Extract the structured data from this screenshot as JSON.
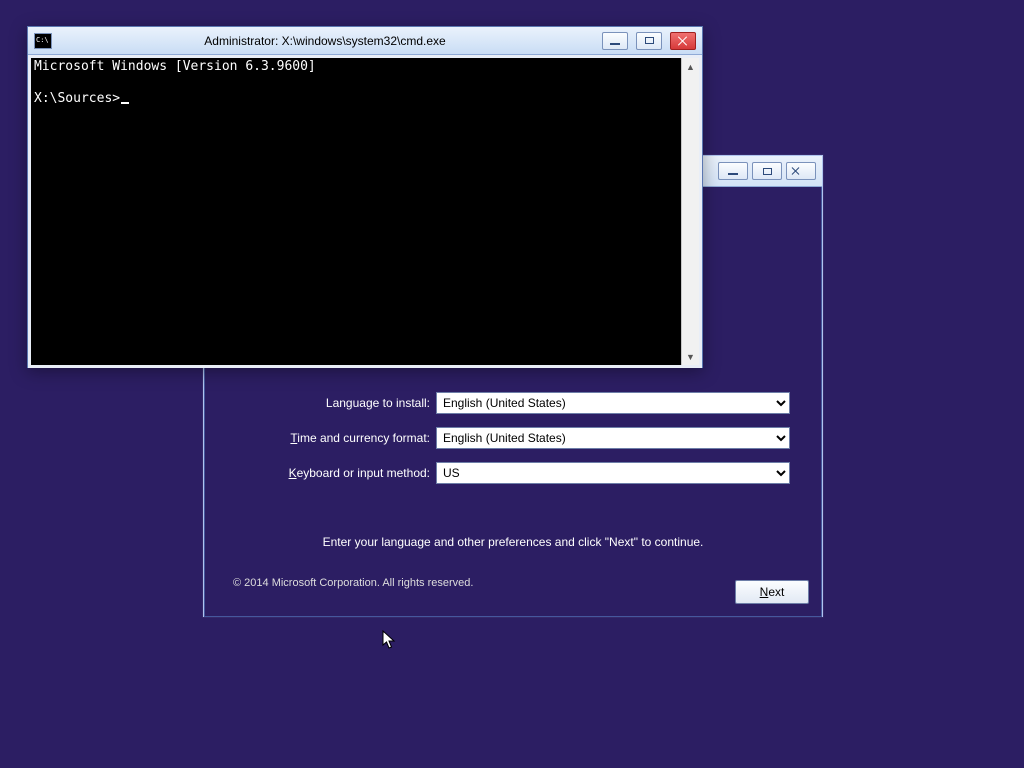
{
  "setup": {
    "titlebar_buttons": {
      "min": "minimize",
      "max": "maximize",
      "close": "close"
    },
    "labels": {
      "language_pre": "Language to install:",
      "time_pre": "ime and currency format:",
      "time_u": "T",
      "keyboard_pre": "eyboard or input method:",
      "keyboard_u": "K"
    },
    "values": {
      "language": "English (United States)",
      "time": "English (United States)",
      "keyboard": "US"
    },
    "hint": "Enter your language and other preferences and click \"Next\" to continue.",
    "copyright": "© 2014 Microsoft Corporation. All rights reserved.",
    "next_pre": "",
    "next_u": "N",
    "next_post": "ext"
  },
  "cmd": {
    "title": "Administrator: X:\\windows\\system32\\cmd.exe",
    "line1": "Microsoft Windows [Version 6.3.9600]",
    "blank": "",
    "prompt": "X:\\Sources>"
  }
}
